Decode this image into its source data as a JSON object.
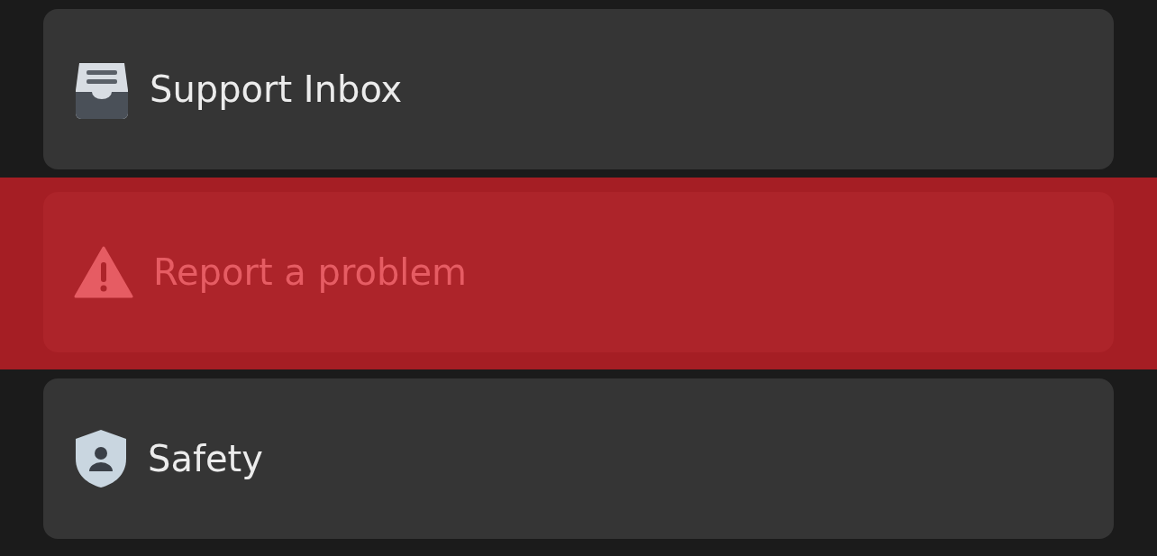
{
  "items": [
    {
      "label": "Support Inbox",
      "kind": "inbox",
      "highlighted": false
    },
    {
      "label": "Report a problem",
      "kind": "warning",
      "highlighted": true
    },
    {
      "label": "Safety",
      "kind": "shield",
      "highlighted": false
    }
  ]
}
